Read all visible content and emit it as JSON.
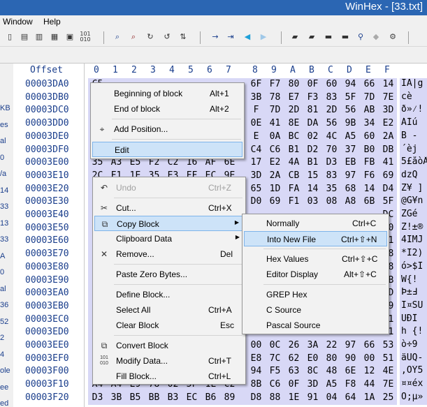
{
  "title": "WinHex - [33.txt]",
  "menubar": {
    "window": "Window",
    "help": "Help"
  },
  "header": {
    "offset": "Offset",
    "cols": [
      "0",
      "1",
      "2",
      "3",
      "4",
      "5",
      "6",
      "7",
      "8",
      "9",
      "A",
      "B",
      "C",
      "D",
      "E",
      "F"
    ]
  },
  "left_panel": [
    "KB",
    "es",
    "al",
    "0",
    "/a",
    "14",
    "33",
    "13",
    "33",
    "A",
    "0",
    "al",
    "36",
    "52",
    "2",
    "4",
    "ole",
    "ee",
    "ed"
  ],
  "rows": [
    {
      "off": "00003DA0",
      "b": [
        "C5",
        "",
        "",
        "",
        "",
        "",
        "",
        "",
        "6F",
        "F7",
        "80",
        "0F",
        "60",
        "94",
        "66",
        "14"
      ],
      "a": "ÏA|g"
    },
    {
      "off": "00003DB0",
      "b": [
        "8",
        "",
        "",
        "",
        "",
        "",
        "",
        "",
        "3B",
        "78",
        "E7",
        "F3",
        "83",
        "5F",
        "7D",
        "7E"
      ],
      "a": "  cè"
    },
    {
      "off": "00003DC0",
      "b": [
        "8",
        "",
        "",
        "",
        "",
        "",
        "",
        "",
        "F",
        "7D",
        "2D",
        "81",
        "2D",
        "56",
        "AB",
        "3D"
      ],
      "a": "ð»⁄!"
    },
    {
      "off": "00003DD0",
      "b": [
        "B",
        "",
        "",
        "",
        "",
        "",
        "",
        "",
        "0E",
        "41",
        "8E",
        "DA",
        "56",
        "9B",
        "34",
        "E2"
      ],
      "a": " ÁÍú"
    },
    {
      "off": "00003DE0",
      "b": [
        "B",
        "",
        "",
        "",
        "",
        "",
        "",
        "",
        "E",
        "0A",
        "BC",
        "02",
        "4C",
        "A5",
        "60",
        "2A"
      ],
      "a": " B -"
    },
    {
      "off": "00003DF0",
      "b": [
        "C",
        "",
        "",
        "",
        "",
        "",
        "",
        "",
        "C4",
        "C6",
        "B1",
        "D2",
        "70",
        "37",
        "B0",
        "DB"
      ],
      "a": "´èj"
    },
    {
      "off": "00003E00",
      "b": [
        "35",
        "A3",
        "E5",
        "F2",
        "C2",
        "16",
        "AF",
        "6E",
        "17",
        "E2",
        "4A",
        "B1",
        "D3",
        "EB",
        "FB",
        "41"
      ],
      "a": "5£åòÂ"
    },
    {
      "off": "00003E10",
      "b": [
        "2C",
        "F1",
        "1E",
        "35",
        "E3",
        "FF",
        "EC",
        "9E",
        "3D",
        "2A",
        "CB",
        "15",
        "83",
        "97",
        "F6",
        "69"
      ],
      "a": "dzQ"
    },
    {
      "off": "00003E20",
      "b": [
        "5",
        "",
        "",
        "",
        "",
        "",
        "",
        "",
        "65",
        "1D",
        "FA",
        "14",
        "35",
        "68",
        "14",
        "D4"
      ],
      "a": "Z¥ ]"
    },
    {
      "off": "00003E30",
      "b": [
        "4",
        "",
        "",
        "",
        "",
        "",
        "",
        "",
        "D0",
        "69",
        "F1",
        "03",
        "08",
        "A8",
        "6B",
        "5F"
      ],
      "a": "@G¥n"
    },
    {
      "off": "00003E40",
      "b": [
        "E",
        "",
        "",
        "",
        "",
        "",
        "",
        "",
        "",
        "",
        "",
        "",
        "",
        "",
        "",
        "DC"
      ],
      "a": "ZGé"
    },
    {
      "off": "00003E50",
      "b": [
        "3",
        "",
        "",
        "",
        "",
        "",
        "",
        "",
        "",
        "",
        "",
        "",
        "",
        "",
        "",
        "60"
      ],
      "a": "Z!±®"
    },
    {
      "off": "00003E60",
      "b": [
        "3",
        "",
        "",
        "",
        "",
        "",
        "",
        "",
        "",
        "",
        "",
        "",
        "",
        "",
        "",
        "A1"
      ],
      "a": "4IMJ"
    },
    {
      "off": "00003E70",
      "b": [
        "5",
        "",
        "",
        "",
        "",
        "",
        "",
        "",
        "",
        "",
        "",
        "",
        "",
        "",
        "",
        "18"
      ],
      "a": "*I2)"
    },
    {
      "off": "00003E80",
      "b": [
        "4",
        "",
        "",
        "",
        "",
        "",
        "",
        "",
        "",
        "",
        "",
        "",
        "",
        "",
        "",
        "28"
      ],
      "a": "ó>$I"
    },
    {
      "off": "00003E90",
      "b": [
        "1",
        "",
        "",
        "",
        "",
        "",
        "",
        "",
        "",
        "",
        "",
        "",
        "",
        "",
        "",
        "7B"
      ],
      "a": " W{!"
    },
    {
      "off": "00003EA0",
      "b": [
        "E",
        "",
        "",
        "",
        "",
        "",
        "",
        "",
        "",
        "",
        "",
        "",
        "",
        "",
        "",
        "2D"
      ],
      "a": "Þ±Ⅎ"
    },
    {
      "off": "00003EB0",
      "b": [
        "4",
        "",
        "",
        "",
        "",
        "",
        "",
        "",
        "",
        "",
        "",
        "",
        "",
        "",
        "",
        "F9"
      ],
      "a": "I¤SÚ"
    },
    {
      "off": "00003EC0",
      "b": [
        "D",
        "",
        "",
        "",
        "",
        "",
        "",
        "",
        "",
        "",
        "",
        "",
        "",
        "",
        "",
        "E1"
      ],
      "a": "ÛÐÎ"
    },
    {
      "off": "00003ED0",
      "b": [
        "6",
        "",
        "",
        "",
        "",
        "",
        "",
        "",
        "42",
        "F2",
        "7B",
        "7E",
        "0D",
        "11",
        "5E",
        "21"
      ],
      "a": "h {!"
    },
    {
      "off": "00003EE0",
      "b": [
        "F",
        "",
        "",
        "",
        "",
        "",
        "",
        "",
        "00",
        "0C",
        "26",
        "3A",
        "22",
        "97",
        "66",
        "53"
      ],
      "a": "ò÷9"
    },
    {
      "off": "00003EF0",
      "b": [
        "E",
        "",
        "",
        "",
        "",
        "",
        "",
        "",
        "E8",
        "7C",
        "62",
        "E0",
        "80",
        "90",
        "00",
        "51"
      ],
      "a": "äÜQ-"
    },
    {
      "off": "00003F00",
      "b": [
        "2",
        "",
        "",
        "",
        "",
        "",
        "",
        "",
        "94",
        "F5",
        "63",
        "8C",
        "48",
        "6E",
        "12",
        "4E"
      ],
      "a": ",OÝ5"
    },
    {
      "off": "00003F10",
      "b": [
        "A4",
        "A4",
        "E9",
        "78",
        "02",
        "5F",
        "1E",
        "C2",
        "8B",
        "C6",
        "0F",
        "3D",
        "A5",
        "F8",
        "44",
        "7E"
      ],
      "a": "¤¤éx"
    },
    {
      "off": "00003F20",
      "b": [
        "D3",
        "3B",
        "B5",
        "BB",
        "B3",
        "EC",
        "B6",
        "89",
        "D8",
        "88",
        "1E",
        "91",
        "04",
        "64",
        "1A",
        "25"
      ],
      "a": "Ó;µ»"
    }
  ],
  "menu1": {
    "items": [
      {
        "label": "Beginning of block",
        "key": "Alt+1"
      },
      {
        "label": "End of block",
        "key": "Alt+2"
      },
      {
        "label": "Add Position...",
        "key": ""
      },
      {
        "label": "Edit",
        "key": ""
      }
    ]
  },
  "menu2": {
    "items": [
      {
        "label": "Undo",
        "key": "Ctrl+Z"
      },
      {
        "label": "Cut...",
        "key": "Ctrl+X"
      },
      {
        "label": "Copy Block",
        "key": ""
      },
      {
        "label": "Clipboard Data",
        "key": ""
      },
      {
        "label": "Remove...",
        "key": "Del"
      },
      {
        "label": "Paste Zero Bytes...",
        "key": ""
      },
      {
        "label": "Define Block...",
        "key": ""
      },
      {
        "label": "Select All",
        "key": "Ctrl+A"
      },
      {
        "label": "Clear Block",
        "key": "Esc"
      },
      {
        "label": "Convert Block",
        "key": ""
      },
      {
        "label": "Modify Data...",
        "key": "Ctrl+T"
      },
      {
        "label": "Fill Block...",
        "key": "Ctrl+L"
      }
    ]
  },
  "menu3": {
    "items": [
      {
        "label": "Normally",
        "key": "Ctrl+C"
      },
      {
        "label": "Into New File",
        "key": "Ctrl+⇧+N"
      },
      {
        "label": "Hex Values",
        "key": "Ctrl+⇧+C"
      },
      {
        "label": "Editor Display",
        "key": "Alt+⇧+C"
      },
      {
        "label": "GREP Hex",
        "key": ""
      },
      {
        "label": "C Source",
        "key": ""
      },
      {
        "label": "Pascal Source",
        "key": ""
      }
    ]
  },
  "toolbar_icons": [
    "new-file-icon",
    "open-file-icon",
    "save-icon",
    "print-icon",
    "properties-icon",
    "binary-icon",
    "find-icon",
    "find-hex-icon",
    "replace-icon",
    "replace-hex-icon",
    "goto-offset-icon",
    "goto-icon",
    "back-icon",
    "forward-icon",
    "disk-icon",
    "disks-icon",
    "ram-icon",
    "search-icon",
    "ram2-icon",
    "gear-icon"
  ],
  "colors": {
    "title_bar": "#2b66b3",
    "selection": "#d8d8f6",
    "menu_highlight": "#cde3f8",
    "offset_text": "#1a3e8c"
  }
}
